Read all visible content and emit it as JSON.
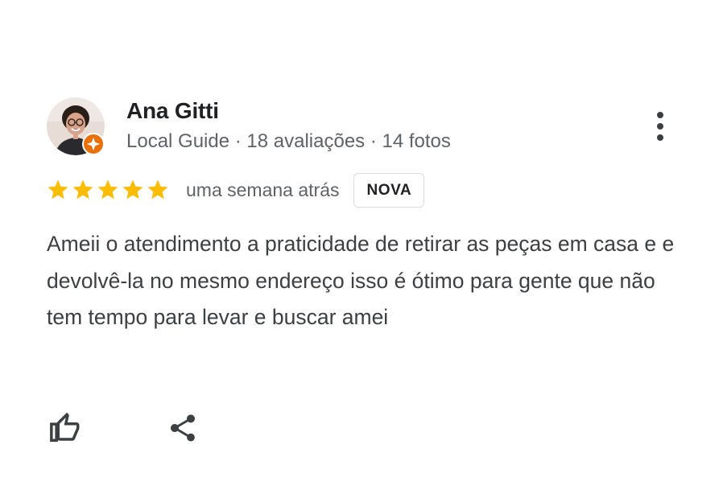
{
  "reviewer": {
    "name": "Ana Gitti",
    "meta": "Local Guide · 18 avaliações · 14 fotos",
    "avatar_icon": "person-photo",
    "badge_icon": "local-guide-star-icon"
  },
  "rating": {
    "stars": 5,
    "max": 5,
    "time": "uma semana atrás",
    "badge": "NOVA"
  },
  "review": {
    "text": "Ameii o atendimento a praticidade de retirar as peças em casa e e devolvê-la no mesmo endereço isso é ótimo para gente que não tem tempo para levar e buscar amei"
  },
  "actions": {
    "like_icon": "thumbs-up-icon",
    "share_icon": "share-icon",
    "more_icon": "more-vert-icon"
  },
  "colors": {
    "star": "#fbbc04",
    "guide_badge": "#e8710a",
    "text_primary": "#202124",
    "text_secondary": "#5f6368",
    "text_body": "#3c4043"
  }
}
